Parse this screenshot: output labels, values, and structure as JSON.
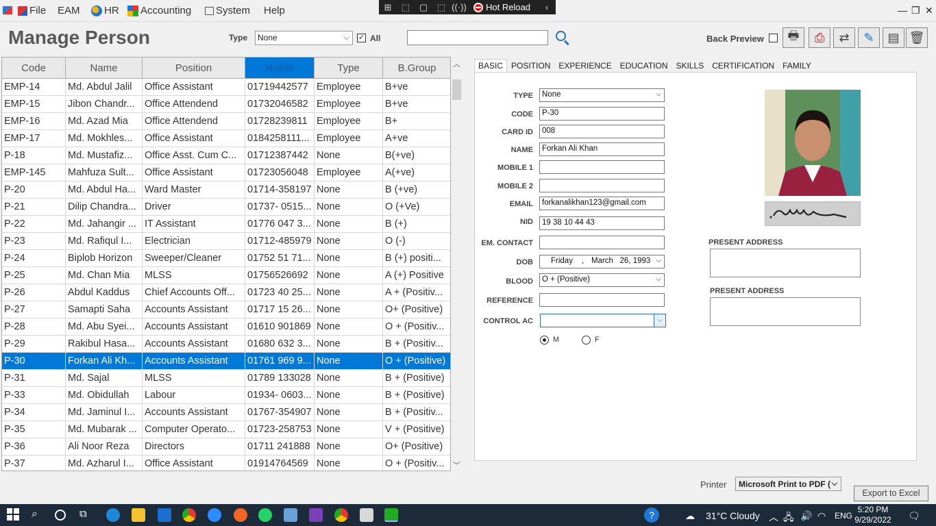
{
  "menu": {
    "file": "File",
    "eam": "EAM",
    "hr": "HR",
    "accounting": "Accounting",
    "system": "System",
    "help": "Help"
  },
  "debug_toolbar": {
    "hot_reload": "Hot Reload"
  },
  "header": {
    "title": "Manage Person",
    "type_label": "Type",
    "type_value": "None",
    "all_label": "All",
    "all_checked": true,
    "search_value": "",
    "back_preview_label": "Back Preview",
    "back_preview_checked": false
  },
  "grid": {
    "columns": [
      "Code",
      "Name",
      "Position",
      "Mobile",
      "Type",
      "B.Group"
    ],
    "selected_column": "Mobile",
    "selected_row_code": "P-30",
    "rows": [
      [
        "EMP-14",
        "Md. Abdul Jalil",
        "Office Assistant",
        "01719442577",
        "Employee",
        "B+ve"
      ],
      [
        "EMP-15",
        "Jibon Chandr...",
        "Office Attendend",
        "01732046582",
        "Employee",
        "B+ve"
      ],
      [
        "EMP-16",
        "Md. Azad Mia",
        "Office Attendend",
        "01728239811",
        "Employee",
        "B+"
      ],
      [
        "EMP-17",
        "Md. Mokhles...",
        "Office Assistant",
        "0184258111...",
        "Employee",
        "A+ve"
      ],
      [
        "P-18",
        "Md. Mustafiz...",
        "Office Asst. Cum C...",
        "01712387442",
        "None",
        "B(+ve)"
      ],
      [
        "EMP-145",
        "Mahfuza Sult...",
        "Office Assistant",
        "01723056048",
        "Employee",
        "A(+ve)"
      ],
      [
        "P-20",
        "Md. Abdul Ha...",
        "Ward Master",
        "01714-358197",
        "None",
        "B (+ve)"
      ],
      [
        "P-21",
        "Dilip Chandra...",
        "Driver",
        "01737- 0515...",
        "None",
        "O (+Ve)"
      ],
      [
        "P-22",
        "Md. Jahangir ...",
        "IT Assistant",
        "01776 047 3...",
        "None",
        "B (+)"
      ],
      [
        "P-23",
        "Md. Rafiqul I...",
        "Electrician",
        "01712-485979",
        "None",
        "O (-)"
      ],
      [
        "P-24",
        "Biplob Horizon",
        "Sweeper/Cleaner",
        "01752 51 71...",
        "None",
        "B (+) positi..."
      ],
      [
        "P-25",
        "Md. Chan Mia",
        "MLSS",
        "01756526692",
        "None",
        "A (+) Positive"
      ],
      [
        "P-26",
        "Abdul Kaddus",
        "Chief Accounts Off...",
        "01723 40 25...",
        "None",
        "A + (Positiv..."
      ],
      [
        "P-27",
        "Samapti Saha",
        "Accounts Assistant",
        "01717 15 26...",
        "None",
        "O+ (Positive)"
      ],
      [
        "P-28",
        "Md. Abu Syei...",
        "Accounts Assistant",
        "01610 901869",
        "None",
        "O + (Positiv..."
      ],
      [
        "P-29",
        "Rakibul Hasa...",
        "Accounts Assistant",
        "01680 632 3...",
        "None",
        "B + (Positiv..."
      ],
      [
        "P-30",
        "Forkan Ali Kh...",
        "Accounts Assistant",
        "01761 969 9...",
        "None",
        "O + (Positive)"
      ],
      [
        "P-31",
        "Md. Sajal",
        "MLSS",
        "01789 133028",
        "None",
        "B + (Positive)"
      ],
      [
        "P-33",
        "Md. Obidullah",
        "Labour",
        "01934- 0603...",
        "None",
        "B + (Positive)"
      ],
      [
        "P-34",
        "Md. Jaminul I...",
        "Accounts Assistant",
        "01767-354907",
        "None",
        "B + (Positiv..."
      ],
      [
        "P-35",
        "Md. Mubarak ...",
        "Computer Operato...",
        "01723-258753",
        "None",
        "V + (Positive)"
      ],
      [
        "P-36",
        "Ali Noor Reza",
        "Directors",
        "01711 241888",
        "None",
        "O+ (Positive)"
      ],
      [
        "P-37",
        "Md. Azharul I...",
        "Office Assistant",
        "01914764569",
        "None",
        "O + (Positiv..."
      ]
    ]
  },
  "tabs": [
    "BASIC",
    "POSITION",
    "EXPERIENCE",
    "EDUCATION",
    "SKILLS",
    "CERTIFICATION",
    "FAMILY"
  ],
  "active_tab": "BASIC",
  "form": {
    "type": {
      "label": "TYPE",
      "value": "None"
    },
    "code": {
      "label": "CODE",
      "value": "P-30"
    },
    "card_id": {
      "label": "CARD ID",
      "value": "008"
    },
    "name": {
      "label": "NAME",
      "value": "Forkan Ali Khan"
    },
    "mobile1": {
      "label": "MOBILE 1",
      "value": ""
    },
    "mobile2": {
      "label": "MOBILE 2",
      "value": ""
    },
    "email": {
      "label": "EMAIL",
      "value": "forkanalikhan123@gmail.com"
    },
    "nid": {
      "label": "NID",
      "value": "19 38 10 44 43"
    },
    "em_contact": {
      "label": "EM. CONTACT",
      "value": ""
    },
    "dob": {
      "label": "DOB",
      "day": "Friday",
      "sep": ",",
      "month_day": "March   26, 1993"
    },
    "blood": {
      "label": "BLOOD",
      "value": "O + (Positive)"
    },
    "reference": {
      "label": "REFERENCE",
      "value": ""
    },
    "control_ac": {
      "label": "CONTROL AC",
      "value": ""
    },
    "gender": {
      "male": "M",
      "female": "F",
      "selected": "M"
    },
    "present_address_1": {
      "label": "PRESENT ADDRESS",
      "value": ""
    },
    "present_address_2": {
      "label": "PRESENT ADDRESS",
      "value": ""
    }
  },
  "footer": {
    "printer_label": "Printer",
    "printer_value": "Microsoft Print to PDF (",
    "export_label": "Export to Excel"
  },
  "taskbar": {
    "weather": "31°C  Cloudy",
    "language": "ENG",
    "time": "5:20 PM",
    "date": "9/29/2022"
  },
  "colors": {
    "selection": "#0078d7",
    "taskbar": "#1c2a3a"
  }
}
